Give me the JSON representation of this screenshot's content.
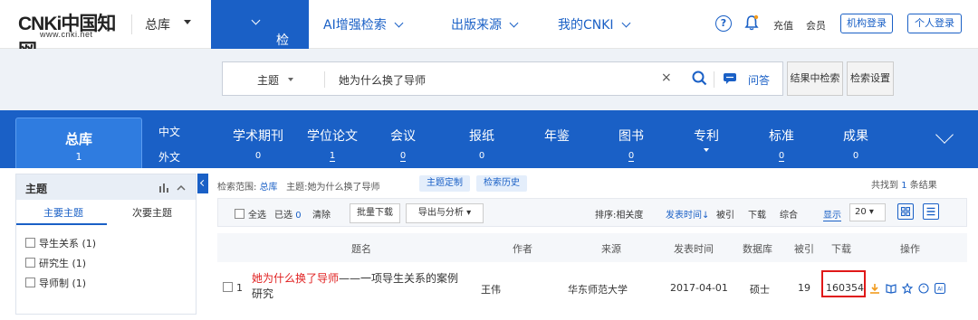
{
  "header": {
    "logo_main": "CNKi中国知网",
    "logo_url": "www.cnki.net",
    "db_label": "总库",
    "nav": [
      {
        "label": "检索"
      },
      {
        "label": "AI增强检索"
      },
      {
        "label": "出版来源"
      },
      {
        "label": "我的CNKI"
      }
    ],
    "help_glyph": "?",
    "links": {
      "recharge": "充值",
      "member": "会员"
    },
    "buttons": {
      "org_login": "机构登录",
      "personal_login": "个人登录"
    }
  },
  "search": {
    "field": "主题",
    "query": "她为什么换了导师",
    "clear": "×",
    "ask": "问答",
    "within_results": "结果中检索",
    "settings": "检索设置"
  },
  "categories": {
    "active": {
      "label": "总库",
      "count": "1"
    },
    "lang_cn": "中文",
    "lang_foreign": "外文",
    "items": [
      {
        "label": "学术期刊",
        "count": "0"
      },
      {
        "label": "学位论文",
        "count": "1"
      },
      {
        "label": "会议",
        "count": "0"
      },
      {
        "label": "报纸",
        "count": "0"
      },
      {
        "label": "年鉴",
        "count": ""
      },
      {
        "label": "图书",
        "count": "0"
      },
      {
        "label": "专利",
        "count": ""
      },
      {
        "label": "标准",
        "count": "0"
      },
      {
        "label": "成果",
        "count": "0"
      }
    ]
  },
  "sidebar": {
    "title": "主题",
    "tab_main": "主要主题",
    "tab_secondary": "次要主题",
    "items": [
      {
        "label": "导生关系 (1)"
      },
      {
        "label": "研究生 (1)"
      },
      {
        "label": "导师制 (1)"
      }
    ]
  },
  "results_meta": {
    "scope_label": "检索范围:",
    "scope_value": "总库",
    "topic_label": "主题:",
    "topic_value": "她为什么换了导师",
    "custom_topic": "主题定制",
    "history": "检索历史",
    "found_prefix": "共找到",
    "found_count": "1",
    "found_suffix": "条结果"
  },
  "toolbar": {
    "select_all": "全选",
    "selected": "已选",
    "selected_count": "0",
    "clear": "清除",
    "batch_download": "批量下载",
    "export": "导出与分析",
    "sort_label": "排序:",
    "sort_relevance": "相关度",
    "sort_time": "发表时间",
    "sort_cited": "被引",
    "sort_download": "下载",
    "sort_overall": "综合",
    "display_label": "显示",
    "display_value": "20"
  },
  "table": {
    "headers": [
      "题名",
      "作者",
      "来源",
      "发表时间",
      "数据库",
      "被引",
      "下载",
      "操作"
    ],
    "rows": [
      {
        "index": "1",
        "title_highlight": "她为什么换了导师",
        "title_rest": "——一项导生关系的案例",
        "title_line2": "研究",
        "author": "王伟",
        "source": "华东师范大学",
        "date": "2017-04-01",
        "db": "硕士",
        "cited": "19",
        "downloads": "160354"
      }
    ]
  },
  "colors": {
    "brand": "#1a60c6",
    "highlight": "#e02020",
    "download_icon": "#f29b1d"
  }
}
